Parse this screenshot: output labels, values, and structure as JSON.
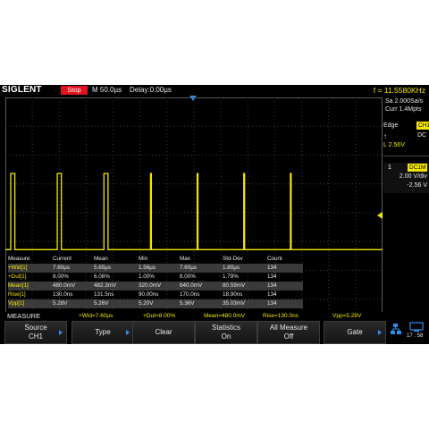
{
  "topbar": {
    "brand": "SIGLENT",
    "run_state": "Stop",
    "timebase": "M 50.0µs",
    "delay": "Delay:0.00µs",
    "frequency": "f = 11.5580KHz"
  },
  "acquisition": {
    "sample_rate": "Sa 2.000Sa/s",
    "memory": "Curr 1.4Mpts"
  },
  "trigger": {
    "type": "Edge",
    "source": "CH1",
    "slope_icon": "rising-edge-icon",
    "coupling": "DC",
    "level": "L  2.56V"
  },
  "channel": {
    "number": "1",
    "coupling": "DC1M",
    "scale": "2.00 V/div",
    "offset": "-2.56 V"
  },
  "measure_table": {
    "headers": [
      "Measure",
      "Current",
      "Mean",
      "Min",
      "Max",
      "Std-Dev",
      "Count"
    ],
    "rows": [
      [
        "+Wid[1]",
        "7.60µs",
        "5.65µs",
        "1.56µs",
        "7.60µs",
        "1.80µs",
        "134"
      ],
      [
        "+Dut[1]",
        "8.00%",
        "6.06%",
        "1.00%",
        "8.00%",
        "1.79%",
        "134"
      ],
      [
        "Mean[1]",
        "480.0mV",
        "482.3mV",
        "320.0mV",
        "640.0mV",
        "80.59mV",
        "134"
      ],
      [
        "Rise[1]",
        "130.0ns",
        "131.5ns",
        "90.00ns",
        "170.0ns",
        "18.90ns",
        "134"
      ],
      [
        "Vpp[1]",
        "5.28V",
        "5.26V",
        "5.20V",
        "5.36V",
        "35.03mV",
        "134"
      ]
    ]
  },
  "measure_strip": {
    "title": "MEASURE",
    "items": [
      "+Wid=7.60µs",
      "+Dut=8.00%",
      "Mean=480.0mV",
      "Rise=130.0ns",
      "Vpp=5.28V"
    ]
  },
  "softkeys": [
    {
      "line1": "Source",
      "line2": "CH1",
      "arrow": true
    },
    {
      "line1": "Type",
      "line2": "",
      "arrow": true
    },
    {
      "line1": "Clear",
      "line2": "",
      "arrow": false
    },
    {
      "line1": "Statistics",
      "line2": "On",
      "arrow": false
    },
    {
      "line1": "All Measure",
      "line2": "Off",
      "arrow": false
    },
    {
      "line1": "Gate",
      "line2": "",
      "arrow": true
    }
  ],
  "status": {
    "time": "17 : 58"
  },
  "colors": {
    "ch1": "#f2e600",
    "stop": "#e0141e",
    "accent": "#2f8fe8",
    "grid": "#3c3c3c"
  },
  "waveform": {
    "channel": "CH1",
    "vertical_scale_v_per_div": 2.0,
    "offset_v": -2.56,
    "low_level_v": 0.0,
    "high_level_v": 5.28,
    "pulse_widths_us": [
      7.6,
      7.6,
      7.6,
      1.56,
      1.56,
      1.56,
      1.56
    ],
    "period_us": 86.5
  }
}
